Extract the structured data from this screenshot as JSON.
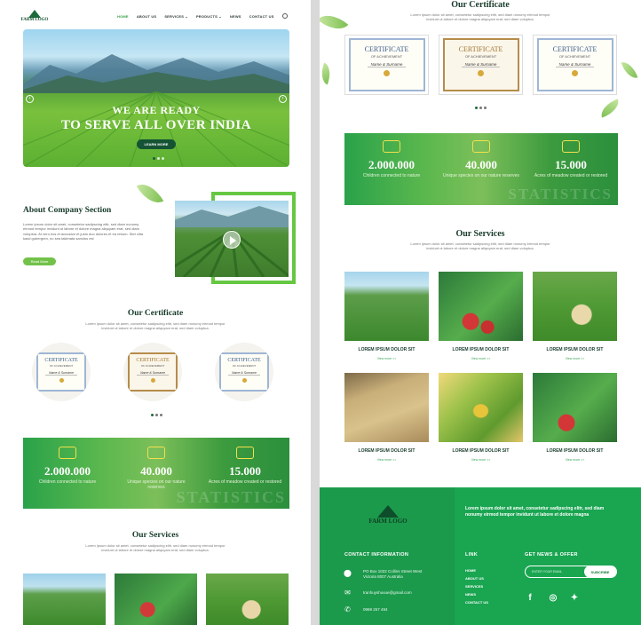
{
  "nav": {
    "logo_text": "FARM LOGO",
    "logo_badge": "",
    "items": [
      "HOME",
      "ABOUT US",
      "SERVICES ⌄",
      "PRODUCTS ⌄",
      "NEWS",
      "CONTACT US"
    ]
  },
  "hero": {
    "line1": "WE ARE READY",
    "line2": "TO SERVE ALL OVER INDIA",
    "button": "LEARN MORE"
  },
  "about": {
    "title": "About Company Section",
    "text": "Lorem ipsum dolor sit amet, consetetur sadipscing elitr, sed diam nonumy eirmod tempor invidunt ut labore et dolore magna aliquyam erat, sed diam voluptua. At vero eos et accusam et justo duo dolores et ea rebum. Stet clita kasd gubergren, no sea takimata sanctus est",
    "button": "Read More"
  },
  "certificate": {
    "title": "Our Certificate",
    "subtitle": "Lorem ipsum dolor sit amet, consetetur sadipscing elitr, sed diam nonumy eirmod tempor invidunt ut labore et dolore magna aliquyam erat, sed diam voluptua.",
    "cert_heading": "CERTIFICATE",
    "cert_sub": "OF ACHIEVEMENT",
    "cert_name": "Name & Surname"
  },
  "stats": {
    "items": [
      {
        "value": "2.000.000",
        "label": "Children connected to nature"
      },
      {
        "value": "40.000",
        "label": "Unique species on our nature reserves"
      },
      {
        "value": "15.000",
        "label": "Acres of meadow created or restored"
      }
    ],
    "watermark": "STATISTICS",
    "icon_color": "#f4e04d"
  },
  "services": {
    "title": "Our Services",
    "subtitle": "Lorem ipsum dolor sit amet, consetetur sadipscing elitr, sed diam nonumy eirmod tempor invidunt ut labore et dolore magna aliquyam erat, sed diam voluptua.",
    "card_title": "LOREM IPSUM DOLOR SIT",
    "card_more": "View more >>"
  },
  "footer": {
    "logo_text": "FARM LOGO",
    "about_text": "Lorem ipsum dolor sit amet, consetetur sadipscing elitr, sed diam nonumy eirmod tempor invidunt ut labore et dolore magna",
    "contact_heading": "CONTACT INFORMATION",
    "address": "PO Box 1022 Collins Street West Victoria 8007 Australia",
    "email": "tranhuyshuvue@gmail.com",
    "phone": "0969 257 494",
    "links_heading": "LINK",
    "links": [
      "HOME",
      "ABOUT US",
      "SERVICES",
      "NEWS",
      "CONTACT US"
    ],
    "news_heading": "GET NEWS & OFFER",
    "news_placeholder": "ENTER YOUR EMAIL",
    "subscribe": "SUBCRIBE",
    "bg_color": "#1aa551"
  }
}
